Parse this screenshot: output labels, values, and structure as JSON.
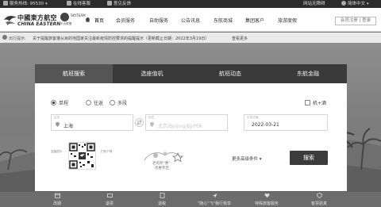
{
  "topbar": {
    "hotline_label": "服务热线: 95530",
    "online_service": "在线客服",
    "feedback": "意见反馈",
    "site_nav": "网站无障碍",
    "language": "简体中文"
  },
  "header": {
    "logo_cn": "中國東方航空",
    "logo_en": "CHINA EASTERN",
    "alliance_name": "SKYTEAM",
    "alliance_sub": "天合联盟",
    "nav": [
      "首页",
      "会员服务",
      "自助服务",
      "公告讯息",
      "东航商城",
      "集团客户",
      "旅游度假"
    ],
    "auth": "会员注册 | 登录"
  },
  "notice": {
    "title": "出行提示:",
    "text": "关于提醒旅客遵从目的地国家关注最新疫情防控要求的提醒提示（更新截止日期：2022年3月19日）",
    "more": "查看更多"
  },
  "booking": {
    "tabs": [
      "航班搜索",
      "选座值机",
      "航班动态",
      "东航金融"
    ],
    "trip_types": [
      "单程",
      "往返",
      "多段"
    ],
    "hotel_checkbox": "机+酒",
    "from_label": "出发",
    "from_value": "上海",
    "to_label": "到达",
    "to_placeholder": "北京/Beijing/BJ/PEK",
    "date_label": "出发日期",
    "date_value": "2022-03-21",
    "qr_left_label": "温馨提示",
    "qr_right_label": "扫码下载",
    "promo_text": "老有所“惠”·\n优惠专区",
    "more_conditions": "更多高级条件",
    "search": "搜索"
  },
  "bottombar": [
    "改期",
    "退票",
    "退税",
    "\"随心\"飞\"我行我享",
    "特殊旅客服务",
    "客票验真"
  ],
  "colors": {
    "topbar_bg": "#2b2b2b",
    "tab_bar": "#3a3a3a",
    "active_tab": "#555555",
    "search_button": "#3b3b3b"
  }
}
